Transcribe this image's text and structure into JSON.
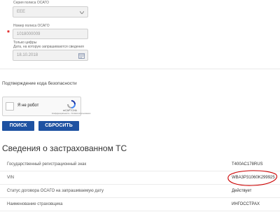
{
  "form": {
    "series_label": "Серия полиса ОСАГО",
    "series_value": "ЕЕЕ",
    "number_label": "Номер полиса ОСАГО",
    "number_value": "1018000009",
    "date_label_line1": "Только цифры",
    "date_label_line2": "Дата, на которую запрашиваются сведения",
    "date_value": "18.10.2018",
    "required_mark": "*"
  },
  "security": {
    "title": "Подтверждение кода безопасности",
    "captcha_label": "Я не робот",
    "captcha_brand": "reCAPTCHA",
    "captcha_links": "Конфиденциальность - Условия использования"
  },
  "buttons": {
    "search": "ПОИСК",
    "reset": "СБРОСИТЬ"
  },
  "results": {
    "heading": "Сведения о застрахованном ТС",
    "rows": [
      {
        "label": "Государственный регистрационный знак",
        "value": "Т400АС178RUS"
      },
      {
        "label": "VIN",
        "value": "WBA3P31060K299925"
      },
      {
        "label": "Статус договора ОСАГО на запрашиваемую дату",
        "value": "Действует"
      },
      {
        "label": "Наименование страховщика",
        "value": "ИНГОССТРАХ"
      }
    ]
  },
  "colors": {
    "accent": "#1e52a2",
    "highlight": "#cc0000"
  }
}
